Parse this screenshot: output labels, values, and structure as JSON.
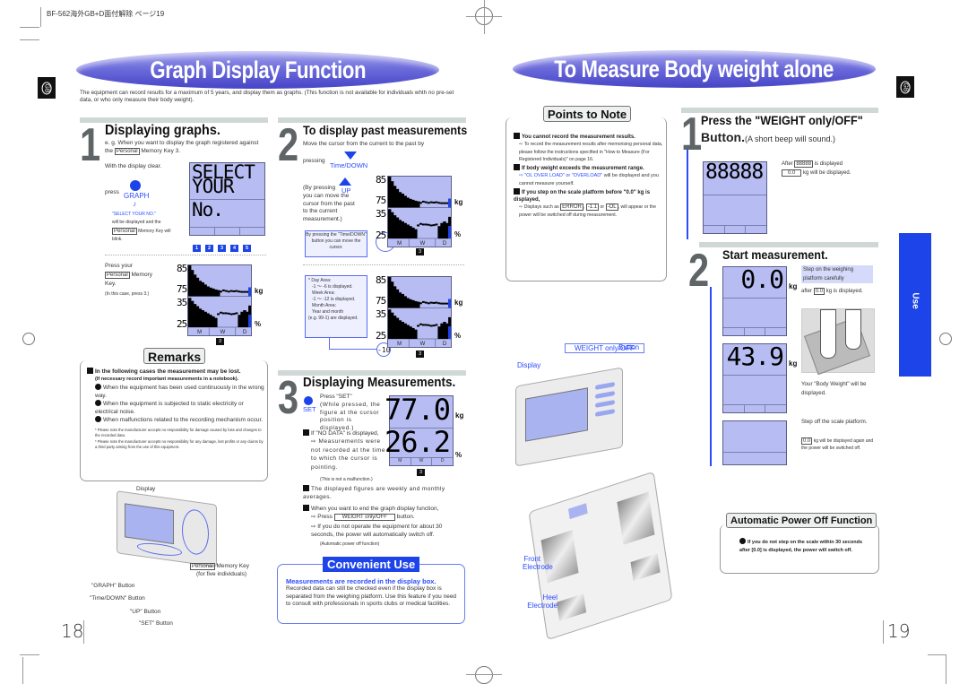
{
  "header": {
    "print_marker": "BF-562海外GB+D面付解除 ページ19",
    "side_tab": "GB"
  },
  "left_page": {
    "title": "Graph Display Function",
    "intro": "The equipment can record results for a maximum of 5 years, and display them as graphs. (This function is not available for individuals whth no pre-set data, or who only measure their body weight).",
    "step1": {
      "number": "1",
      "title": "Displaying graphs.",
      "subtitle_a": "e. g. When you want to display the graph registered against the",
      "subtitle_key": "Personal",
      "subtitle_b": "Memory Key 3.",
      "display_clear": "With the display clear.",
      "press": "press",
      "graph_btn": "GRAPH",
      "note_icon": "♪",
      "select_msg": "\"SELECT YOUR NO.\"",
      "select_rest_a": "will be displayed and the",
      "select_key": "Personal",
      "select_rest_b": "Memory Key will blink.",
      "lcd_line1": "SELECT",
      "lcd_line2": "YOUR",
      "lcd_line3": "No.",
      "memory_keys": [
        "1",
        "2",
        "3",
        "4",
        "5"
      ],
      "press_your": "Press your",
      "press_key": "Personal",
      "press_rest": "Memory Key.",
      "press_note": "(In this case, press 3.)",
      "graph": {
        "y_top": [
          "85",
          "75"
        ],
        "y_bottom": [
          "35",
          "25"
        ],
        "unit_top": "kg",
        "unit_bottom": "%",
        "areas": [
          "M",
          "W",
          "D"
        ],
        "key": "3"
      }
    },
    "step2": {
      "number": "2",
      "title": "To display past measurements",
      "subtitle": "Move the cursor from the current to the past by",
      "pressing": "pressing",
      "down_btn": "Time/DOWN",
      "up_text_a": "(By pressing",
      "up_btn": "UP",
      "up_text_b": "you can move the cursor from the past to the current measurement.)",
      "callout": "By pressing the \"Time/DOWN\" button you can move the cursor.",
      "area_note": {
        "day_title": "* Day Area:",
        "day_range": "-1 ～ -6 is displayed.",
        "week_title": "Week Area:",
        "week_range": "-1 ～ -12 is displayed.",
        "month_title": "Month Area:",
        "month_range": "Year and month",
        "month_example": "(e.g. 99-1) are displayed."
      },
      "cursor_value": "-10",
      "graph": {
        "y_top": [
          "85",
          "75"
        ],
        "y_bottom": [
          "35",
          "25"
        ],
        "unit_top": "kg",
        "unit_bottom": "%",
        "areas": [
          "M",
          "W",
          "D"
        ],
        "key": "3"
      }
    },
    "remarks": {
      "title": "Remarks",
      "heading": "In the following cases the measurement may be lost.",
      "subheading": "(If necessary record important measurements in a notebook).",
      "items": [
        "When the equipment has been used continuously in the wrong way.",
        "When the equipment is subjected to static electricity or electrical noise.",
        "When malfunctions related to the recording mechanism occur."
      ],
      "notes": [
        "* Please note the manufacturer accepts no responsibility for damage caused by loss and changes to the recorded data.",
        "* Please note the manufacturer accepts no responsibility for any damage, lost profits or any claims by a third party arising from the use of this equipment."
      ]
    },
    "device_diagram": {
      "display": "Display",
      "personal_key": "Personal",
      "memory_key": "Memory Key",
      "for_five": "(for five individuals)",
      "graph_button": "\"GRAPH\" Button",
      "time_down_button": "\"Time/DOWN\" Button",
      "up_button": "\"UP\" Button",
      "set_button": "\"SET\" Button"
    },
    "step3": {
      "number": "3",
      "title": "Displaying Measurements.",
      "set_btn": "SET",
      "press_set": "Press \"SET\"",
      "press_set_note": "(While pressed, the figure at the cursor position is displayed.)",
      "no_data": "If \"NO DATA\" is displayed,",
      "no_data_note": "⇨ Measurements were not recorded at the time to which the cursor is pointing.",
      "no_data_note2": "(This is not a malfunction.)",
      "averages": "The displayed figures are weekly and monthly averages.",
      "end_graph": "When you want to end the graph display function,",
      "end_press": "⇨ Press",
      "end_key": "WEIGHT only/OFF",
      "end_button": "button.",
      "auto_off": "⇨ If you do not operate the equipment for about 30 seconds, the power will automatically switch off.",
      "auto_off_note": "(Automatic power off function)",
      "lcd_weight": "77.0",
      "lcd_fat": "26.2",
      "unit_kg": "kg",
      "unit_pct": "%",
      "areas": [
        "M",
        "W",
        "D"
      ],
      "key": "3"
    },
    "convenient": {
      "title": "Convenient Use",
      "heading": "Measurements are recorded in the display box.",
      "body": "Recorded data can still be checked even if the display box is separated from the weighing platform. Use this feature if you need to consult with professionals in sports clubs or medical facilities."
    },
    "page_number": "18"
  },
  "right_page": {
    "title": "To Measure Body weight alone",
    "side_tab": "GB",
    "points": {
      "title": "Points to Note",
      "items": [
        {
          "heading": "You cannot record the measurement results.",
          "body": "⇨ To record the measurement results after memorising personal data, please follow the instructions specified in \"How to Measure (For Registered Individuals)\" on page 16."
        },
        {
          "heading": "If body weight exceeds the measurement range.",
          "body_blue": "⇨ \"OL OVER LOAD\" or \"OVERLOAD\"",
          "body": "will be displayed and you cannot measure yourself."
        },
        {
          "heading": "If you step on the scale platform before \"0.0\" kg is displayed,",
          "body_a": "⇨ Displays such as",
          "codes": [
            "ERROR",
            "-1.1",
            "-OL"
          ],
          "body_b": "will appear or the power will be switched off during measurement."
        }
      ]
    },
    "diagram": {
      "weight_key": "WEIGHT only/OFF",
      "button": "Button",
      "display": "Display",
      "front_electrode": "Front Electrode",
      "heel_electrode": "Heel Electrode"
    },
    "step1": {
      "number": "1",
      "title_a": "Press the \"WEIGHT only/OFF\"",
      "title_b": "Button.",
      "title_note": "(A short beep will sound.)",
      "lcd": "88888",
      "after": "After",
      "after_code": "88888",
      "after_rest": "is displayed",
      "zero": "0.0",
      "zero_rest": "kg will be displayed."
    },
    "step2": {
      "number": "2",
      "title": "Start measurement.",
      "lcd_zero": "0.0",
      "lcd_weight": "43.9",
      "unit": "kg",
      "step_on": "Step on the weighing platform carefully",
      "after": "after",
      "after_code": "0.0",
      "after_rest": "kg is displayed.",
      "your_weight": "Your \"Body Weight\" will be displayed.",
      "step_off": "Step off the scale platform.",
      "step_off_code": "0.0",
      "step_off_note": "kg will be displayed again and the power will be switched off."
    },
    "auto_off": {
      "title": "Automatic Power Off Function",
      "body": "If you do not step on the scale within 30 seconds after [0.0] is displayed, the power will switch off."
    },
    "use_tab": "Use",
    "page_number": "19"
  },
  "colors": {
    "accent_blue": "#2a4bff",
    "lcd": "#b7bdf2",
    "banner": "#5b5ad2"
  }
}
